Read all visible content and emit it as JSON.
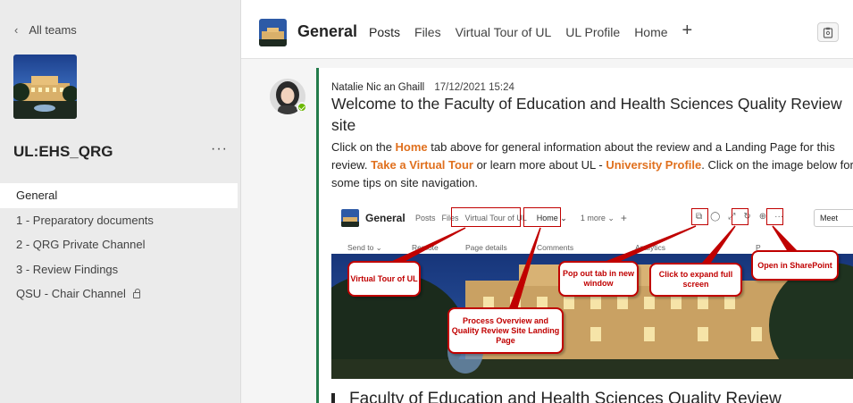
{
  "sidebar": {
    "back_label": "All teams",
    "team_name": "UL:EHS_QRG",
    "more_label": "···",
    "channels": [
      {
        "label": "General"
      },
      {
        "label": "1 - Preparatory documents"
      },
      {
        "label": "2 - QRG Private Channel"
      },
      {
        "label": "3 - Review Findings"
      },
      {
        "label": "QSU - Chair Channel"
      }
    ]
  },
  "header": {
    "channel_title": "General",
    "tabs": [
      "Posts",
      "Files",
      "Virtual Tour of UL",
      "UL Profile",
      "Home"
    ],
    "add_tab": "+"
  },
  "post": {
    "author": "Natalie Nic an Ghaill",
    "timestamp": "17/12/2021 15:24",
    "title": "Welcome to the Faculty of Education and Health Sciences Quality Review site",
    "body": {
      "p1": "Click on the ",
      "home_link": "Home",
      "p2": " tab above for general information about the review and a Landing Page for this review. ",
      "tour_link": "Take a Virtual Tour",
      "p3": " or learn more about UL - ",
      "profile_link": "University Profile",
      "p4": ". Click on the image below for some tips on site navigation."
    }
  },
  "embed": {
    "title": "General",
    "tabs": [
      "Posts",
      "Files",
      "Virtual Tour of UL",
      "Home ⌄",
      "1 more ⌄",
      "+"
    ],
    "meet_label": "Meet",
    "toolbar": [
      "Send to ⌄",
      "Remote",
      "Page details",
      "Comments",
      "Analytics"
    ],
    "published_partial": "P",
    "footer_title": "Faculty of Education and Health Sciences Quality Review",
    "callouts": {
      "virtual_tour": "Virtual Tour of UL",
      "process_overview": "Process Overview and Quality Review Site Landing Page",
      "pop_out": "Pop out tab in new window",
      "expand": "Click to expand full screen",
      "sharepoint": "Open in SharePoint"
    }
  },
  "colors": {
    "accent": "#5b5fc7",
    "post_border": "#237b4b",
    "link_orange": "#e0701e",
    "callout_red": "#c00000",
    "presence_green": "#6bb700"
  }
}
